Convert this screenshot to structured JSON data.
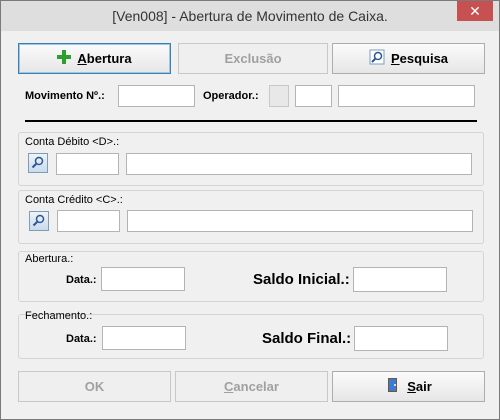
{
  "window": {
    "title": "[Ven008] - Abertura de Movimento de Caixa.",
    "close_glyph": "✕"
  },
  "toolbar": {
    "abertura": {
      "label_first": "A",
      "label_rest": "bertura"
    },
    "exclusao": {
      "label": "Exclusão"
    },
    "pesquisa": {
      "label_first": "P",
      "label_rest": "esquisa"
    }
  },
  "header_fields": {
    "movimento_label": "Movimento Nº.:",
    "movimento_value": "",
    "operador_label": "Operador.:",
    "operador_value": "",
    "operador_name": ""
  },
  "conta_debito": {
    "label": "Conta Débito <D>.:",
    "code": "",
    "description": ""
  },
  "conta_credito": {
    "label": "Conta Crédito <C>.:",
    "code": "",
    "description": ""
  },
  "abertura": {
    "label": "Abertura.:",
    "data_label": "Data.:",
    "data_value": "",
    "saldo_label": "Saldo Inicial.:",
    "saldo_value": ""
  },
  "fechamento": {
    "label": "Fechamento.:",
    "data_label": "Data.:",
    "data_value": "",
    "saldo_label": "Saldo Final.:",
    "saldo_value": ""
  },
  "footer": {
    "ok": {
      "label": "OK"
    },
    "cancelar": {
      "label_first": "C",
      "label_rest": "ancelar"
    },
    "sair": {
      "label_first": "S",
      "label_rest": "air"
    }
  },
  "colors": {
    "plus_icon": "#2e9e2e",
    "close_button": "#c75050"
  },
  "icons": [
    "plus-icon",
    "search-icon",
    "exit-door-icon",
    "close-icon",
    "lookup-icon"
  ]
}
